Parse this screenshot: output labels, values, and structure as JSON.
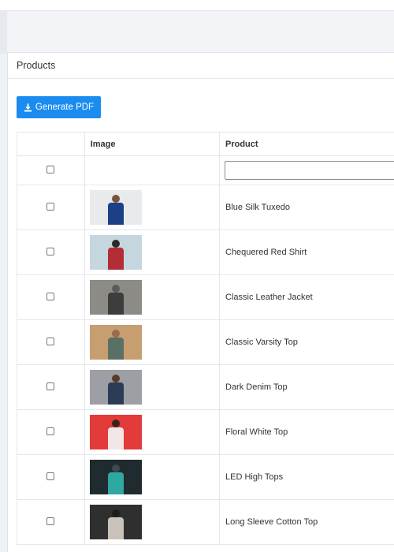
{
  "panel": {
    "title": "Products"
  },
  "toolbar": {
    "generate_pdf_label": "Generate PDF"
  },
  "table": {
    "columns": [
      "Image",
      "Product"
    ],
    "filter": {
      "value": "",
      "placeholder": ""
    },
    "rows": [
      {
        "name": "Blue Silk Tuxedo"
      },
      {
        "name": "Chequered Red Shirt"
      },
      {
        "name": "Classic Leather Jacket"
      },
      {
        "name": "Classic Varsity Top"
      },
      {
        "name": "Dark Denim Top"
      },
      {
        "name": "Floral White Top"
      },
      {
        "name": "LED High Tops"
      },
      {
        "name": "Long Sleeve Cotton Top"
      }
    ]
  },
  "colors": {
    "accent": "#1a8cf0",
    "thumbs": [
      {
        "bg": "#e8eaec",
        "head": "#7a5438",
        "body": "#1d3f86"
      },
      {
        "bg": "#c5d6de",
        "head": "#2a2a2a",
        "body": "#b32d36"
      },
      {
        "bg": "#8d8b86",
        "head": "#5c5b58",
        "body": "#3d3d3d"
      },
      {
        "bg": "#c79e6f",
        "head": "#9b6a4a",
        "body": "#5a7064"
      },
      {
        "bg": "#9d9fa4",
        "head": "#5a3b2a",
        "body": "#2b3d56"
      },
      {
        "bg": "#e33a3a",
        "head": "#3a2418",
        "body": "#f2e6e6"
      },
      {
        "bg": "#1f2b2f",
        "head": "#3d4b4f",
        "body": "#2ea8a0"
      },
      {
        "bg": "#2f2f2f",
        "head": "#1c1c1c",
        "body": "#c9c2b8"
      }
    ]
  }
}
